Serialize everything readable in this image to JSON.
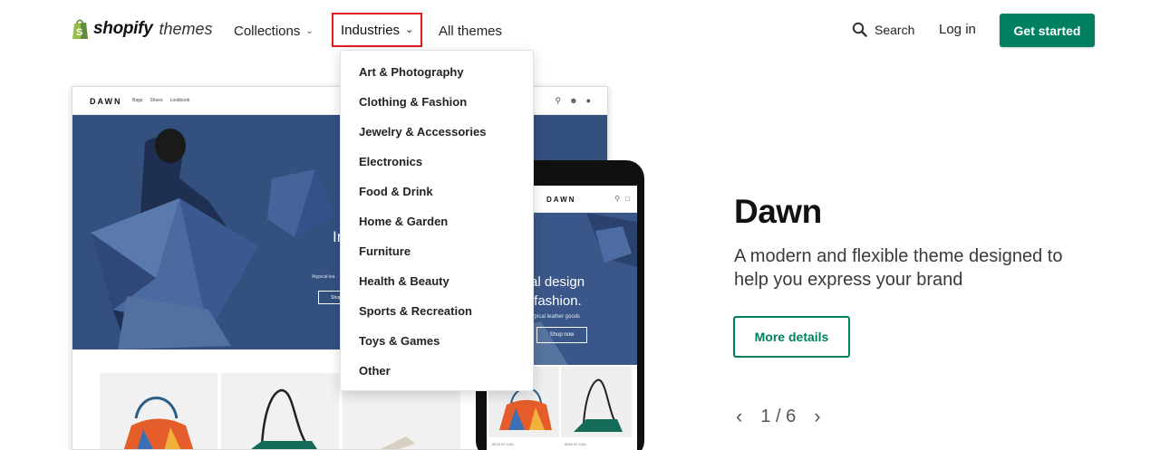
{
  "brand": {
    "logo_bold": "shopify",
    "logo_light": "themes",
    "logo_icon": "shopping-bag-icon",
    "brand_color": "#008060"
  },
  "nav": {
    "collections_label": "Collections",
    "industries_label": "Industries",
    "all_themes_label": "All themes",
    "search_label": "Search",
    "login_label": "Log in",
    "cta_label": "Get started",
    "highlight_color": "#e01d1d"
  },
  "industries_menu": {
    "items": [
      {
        "label": "Art & Photography"
      },
      {
        "label": "Clothing & Fashion"
      },
      {
        "label": "Jewelry & Accessories"
      },
      {
        "label": "Electronics"
      },
      {
        "label": "Food & Drink"
      },
      {
        "label": "Home & Garden"
      },
      {
        "label": "Furniture"
      },
      {
        "label": "Health & Beauty"
      },
      {
        "label": "Sports & Recreation"
      },
      {
        "label": "Toys & Games"
      },
      {
        "label": "Other"
      }
    ]
  },
  "preview": {
    "desktop": {
      "brand": "DAWN",
      "nav_links": [
        "Bags",
        "Shoes",
        "Lookbook"
      ],
      "hero_line1": "Industrial",
      "hero_line2": "meets f",
      "hero_sub": "Atypical lea",
      "hero_btn": "Shop"
    },
    "phone": {
      "brand": "DAWN",
      "hero_line1": "strial design",
      "hero_line2": "ets fashion.",
      "hero_sub": "typical leather goods",
      "hero_btn": "Shop now",
      "price1": "$378.00 CAD",
      "price2": "$390.00 CAD"
    }
  },
  "theme": {
    "name": "Dawn",
    "description": "A modern and flexible theme designed to help you express your brand",
    "details_label": "More details"
  },
  "pager": {
    "text": "1 / 6",
    "prev_icon": "chevron-left-icon",
    "next_icon": "chevron-right-icon"
  }
}
